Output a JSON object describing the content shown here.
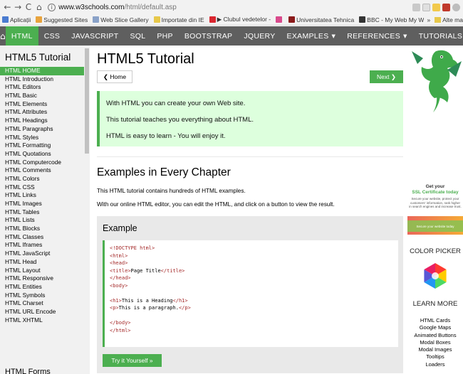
{
  "browser": {
    "nav_back": "←",
    "nav_forward": "→",
    "reload": "C",
    "home": "⌂",
    "url_host": "www.w3schools.com",
    "url_path": "/html/default.asp",
    "bookmarks": [
      {
        "label": "Aplicații",
        "icon_color": "#4a7bd0"
      },
      {
        "label": "Suggested Sites",
        "icon_color": "#e8a33d"
      },
      {
        "label": "Web Slice Gallery",
        "icon_color": "#8aa2c8"
      },
      {
        "label": "Importate din IE",
        "icon_color": "#e7c84a"
      },
      {
        "label": "▶ Clubul vedetelor -",
        "icon_color": "#d9262f"
      },
      {
        "label": "",
        "icon_color": "#d94a8c"
      },
      {
        "label": "Universitatea Tehnica",
        "icon_color": "#8b1a1a"
      },
      {
        "label": "BBC - My Web My W",
        "icon_color": "#333333"
      }
    ],
    "bookmarks_more": "»",
    "other_bookmarks": "Alte ma"
  },
  "topnav": {
    "home_icon": "⌂",
    "items": [
      "HTML",
      "CSS",
      "JAVASCRIPT",
      "SQL",
      "PHP",
      "BOOTSTRAP",
      "JQUERY"
    ],
    "dropdowns": [
      "EXAMPLES",
      "REFERENCES",
      "TUTORIALS"
    ],
    "caret": "▼",
    "more": "C"
  },
  "sidebar": {
    "title": "HTML5 Tutorial",
    "links": [
      "HTML HOME",
      "HTML Introduction",
      "HTML Editors",
      "HTML Basic",
      "HTML Elements",
      "HTML Attributes",
      "HTML Headings",
      "HTML Paragraphs",
      "HTML Styles",
      "HTML Formatting",
      "HTML Quotations",
      "HTML Computercode",
      "HTML Comments",
      "HTML Colors",
      "HTML CSS",
      "HTML Links",
      "HTML Images",
      "HTML Tables",
      "HTML Lists",
      "HTML Blocks",
      "HTML Classes",
      "HTML Iframes",
      "HTML JavaScript",
      "HTML Head",
      "HTML Layout",
      "HTML Responsive",
      "HTML Entities",
      "HTML Symbols",
      "HTML Charset",
      "HTML URL Encode",
      "HTML XHTML"
    ],
    "forms_title": "HTML Forms"
  },
  "main": {
    "title": "HTML5 Tutorial",
    "home_button": "❮ Home",
    "next_button": "Next ❯",
    "intro": [
      "With HTML you can create your own Web site.",
      "This tutorial teaches you everything about HTML.",
      "HTML is easy to learn - You will enjoy it."
    ],
    "examples_title": "Examples in Every Chapter",
    "examples_p1": "This HTML tutorial contains hundreds of HTML examples.",
    "examples_p2": "With our online HTML editor, you can edit the HTML, and click on a button to view the result.",
    "example_box_title": "Example",
    "code_lines": [
      "<!DOCTYPE html>",
      "<html>",
      "<head>",
      "<title>Page Title</title>",
      "</head>",
      "<body>",
      "",
      "<h1>This is a Heading</h1>",
      "<p>This is a paragraph.</p>",
      "",
      "</body>",
      "</html>"
    ],
    "try_button": "Try it Yourself »"
  },
  "right": {
    "ad_title_1": "Get your",
    "ad_title_2": "SSL Certificate today",
    "ad_body": "Secure your website, protect your customers' information, rank higher in search engines and increase trust.",
    "ad_button": "Secure your website today",
    "color_picker_title": "COLOR PICKER",
    "learn_more_title": "LEARN MORE",
    "learn_more_links": [
      "HTML Cards",
      "Google Maps",
      "Animated Buttons",
      "Modal Boxes",
      "Modal Images",
      "Tooltips",
      "Loaders"
    ]
  },
  "colors": {
    "accent_green": "#4caf50",
    "topnav_bg": "#5f5f5f",
    "intro_bg": "#ddffdd",
    "sidebar_bg": "#f1f1f1",
    "example_bg": "#e9e9e9",
    "code_tag": "#a52a2a"
  }
}
